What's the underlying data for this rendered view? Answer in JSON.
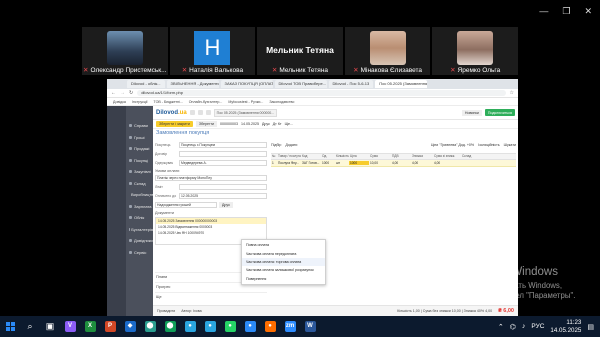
{
  "zoom": {
    "participants": [
      {
        "name": "Олександр Пристемськ..."
      },
      {
        "name": "Наталія Валькова",
        "initial": "H"
      },
      {
        "name": "Мельник Тетяна",
        "big_name": "Мельник Тетяна"
      },
      {
        "name": "Мінакова Єлизавета"
      },
      {
        "name": "Яремко Ольга"
      }
    ]
  },
  "browser": {
    "tabs": [
      "Dilovod - облік...",
      "ЗВІЛЬНЕННЯ - Документи...",
      "ЗАКАЗ ПОКУПЦЯ (ОПЛАТ...",
      "Dilovod ТОВ Правобере...",
      "Dilovod - Пос 5-6-13",
      "Пос 05.2025 (Замовлення..."
    ],
    "url": "dilovod.ua/1/1/form.php",
    "bookmarks": [
      "Довідка",
      "Інструкції",
      "ТОВ - Бюджетні...",
      "Онлайн-бухгалтер...",
      "Myfocustest - Ручки...",
      "Зaкoнoдaвcтвo"
    ]
  },
  "app": {
    "logo_main": "Dilovod",
    "logo_sub": ".ua",
    "open_doc": "Пос 05.2025 (Замовлення 000000...",
    "subscribe": "Подключиться",
    "header_btn": "Новинки",
    "nav": [
      "Справи",
      "Гроші",
      "Продажі",
      "Покупці",
      "Закупівлі",
      "Склад",
      "Виробництво",
      "Зарплата",
      "Облік",
      "Бухгалтерія",
      "Довідники",
      "Сервіс"
    ],
    "toolbar": {
      "save_close": "Зберегти і закрити",
      "save": "Зберегти",
      "print": "Друк",
      "dt_kt": "Дт Кт",
      "more": "Ще..."
    },
    "doc": {
      "title": "Замовлення покупця",
      "number": "000000003",
      "date": "14.05.2025"
    },
    "form": {
      "buyer_label": "Покупець",
      "buyer_value": "Покупець з Покупцем",
      "contract_label": "Договір",
      "recipient_label": "Одержувач",
      "recipient_value": "Медведерева А.",
      "payment_label": "Умови оплати",
      "payment_value": "Платіж через платформу МоноПлу",
      "limit_label": "Ліміт",
      "paid_label": "Оплачено до",
      "paid_value": "12.05.2025",
      "create_label": "Надходження грошей",
      "print_btn": "Друк",
      "documents_label": "Документи",
      "docs": [
        "14.05.2025 Замовлення 000000000003",
        "14.05.2025 Відвантаження 0000003",
        "14.05.2025 Чек ФН 100094970"
      ],
      "sections": [
        "Плани",
        "Прогрес",
        "Ще"
      ]
    },
    "dropdown": [
      "Повна оплата",
      "Часткова оплата передоплата",
      "Часткова оплата: торгова оплата",
      "Часткова оплата залишкової розрахунок",
      "Повернення"
    ],
    "table": {
      "tools": [
        "Підбір",
        "Додати",
        "Ціни \"Гривнева\" Дод. +0%",
        "Ізоляційність",
        "Шукати"
      ],
      "headers": [
        "№",
        "Товар / послуга",
        "Код",
        "Од.",
        "Кількість",
        "Ціна",
        "Сума",
        "ПДВ",
        "Знижка",
        "Сума зі знижк.",
        "Склад"
      ],
      "rows": [
        [
          "1",
          "Послуга Флу...",
          "ЗАГ Готов...",
          "1000",
          "шт",
          "1000",
          "10,00",
          "4,00",
          "4,00",
          "4,00",
          ""
        ]
      ]
    },
    "status": {
      "left": "Провадити",
      "author": "Автор: Іхова",
      "summary": "Кількість 1,00 | Сума без знижки 10,00 | Знижка 40% 4,00",
      "total": "6,00"
    }
  },
  "watermark": {
    "title": "Активация Windows",
    "line1": "Чтобы активировать Windows,",
    "line2": "перейдите в раздел \"Параметры\"."
  },
  "taskbar": {
    "lang": "РУС",
    "time": "11:23",
    "date": "14.05.2025",
    "apps": [
      {
        "label": "V",
        "color": "#8b5cf6"
      },
      {
        "label": "X",
        "color": "#1e8e3e"
      },
      {
        "label": "P",
        "color": "#d24726"
      },
      {
        "label": "◆",
        "color": "#1b6ac9"
      },
      {
        "label": "⬤",
        "color": "#2a9d8f"
      },
      {
        "label": "⬤",
        "color": "#0f9d58"
      },
      {
        "label": "●",
        "color": "#2aa5e0"
      },
      {
        "label": "●",
        "color": "#2aa5e0"
      },
      {
        "label": "●",
        "color": "#25d366"
      },
      {
        "label": "●",
        "color": "#2b8af7"
      },
      {
        "label": "●",
        "color": "#ff6d00"
      },
      {
        "label": "zm",
        "color": "#2d8cff"
      },
      {
        "label": "W",
        "color": "#2b579a"
      }
    ]
  }
}
